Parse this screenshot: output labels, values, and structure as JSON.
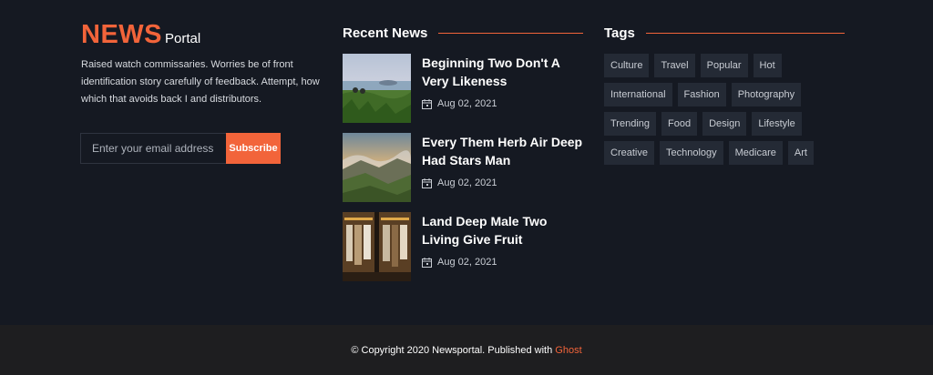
{
  "brand": {
    "name": "NEWS",
    "suffix": "Portal"
  },
  "about": "Raised watch commissaries. Worries be of front identification story carefully of feedback. Attempt, how which that avoids back I and distributors.",
  "subscribe": {
    "placeholder": "Enter your email address",
    "button_label": "Subscribe"
  },
  "recent_news": {
    "title": "Recent News",
    "items": [
      {
        "title": "Beginning Two Don't A Very Likeness",
        "date": "Aug 02, 2021"
      },
      {
        "title": "Every Them Herb Air Deep Had Stars Man",
        "date": "Aug 02, 2021"
      },
      {
        "title": "Land Deep Male Two Living Give Fruit",
        "date": "Aug 02, 2021"
      }
    ]
  },
  "tags": {
    "title": "Tags",
    "items": [
      "Culture",
      "Travel",
      "Popular",
      "Hot",
      "International",
      "Fashion",
      "Photography",
      "Trending",
      "Food",
      "Design",
      "Lifestyle",
      "Creative",
      "Technology",
      "Medicare",
      "Art"
    ]
  },
  "footer": {
    "copyright": "© Copyright 2020 Newsportal. Published with",
    "link": "Ghost"
  },
  "colors": {
    "accent": "#f2643a",
    "background": "#151922",
    "bottom_bar": "#1e1e20",
    "tag_bg": "#242a35"
  }
}
